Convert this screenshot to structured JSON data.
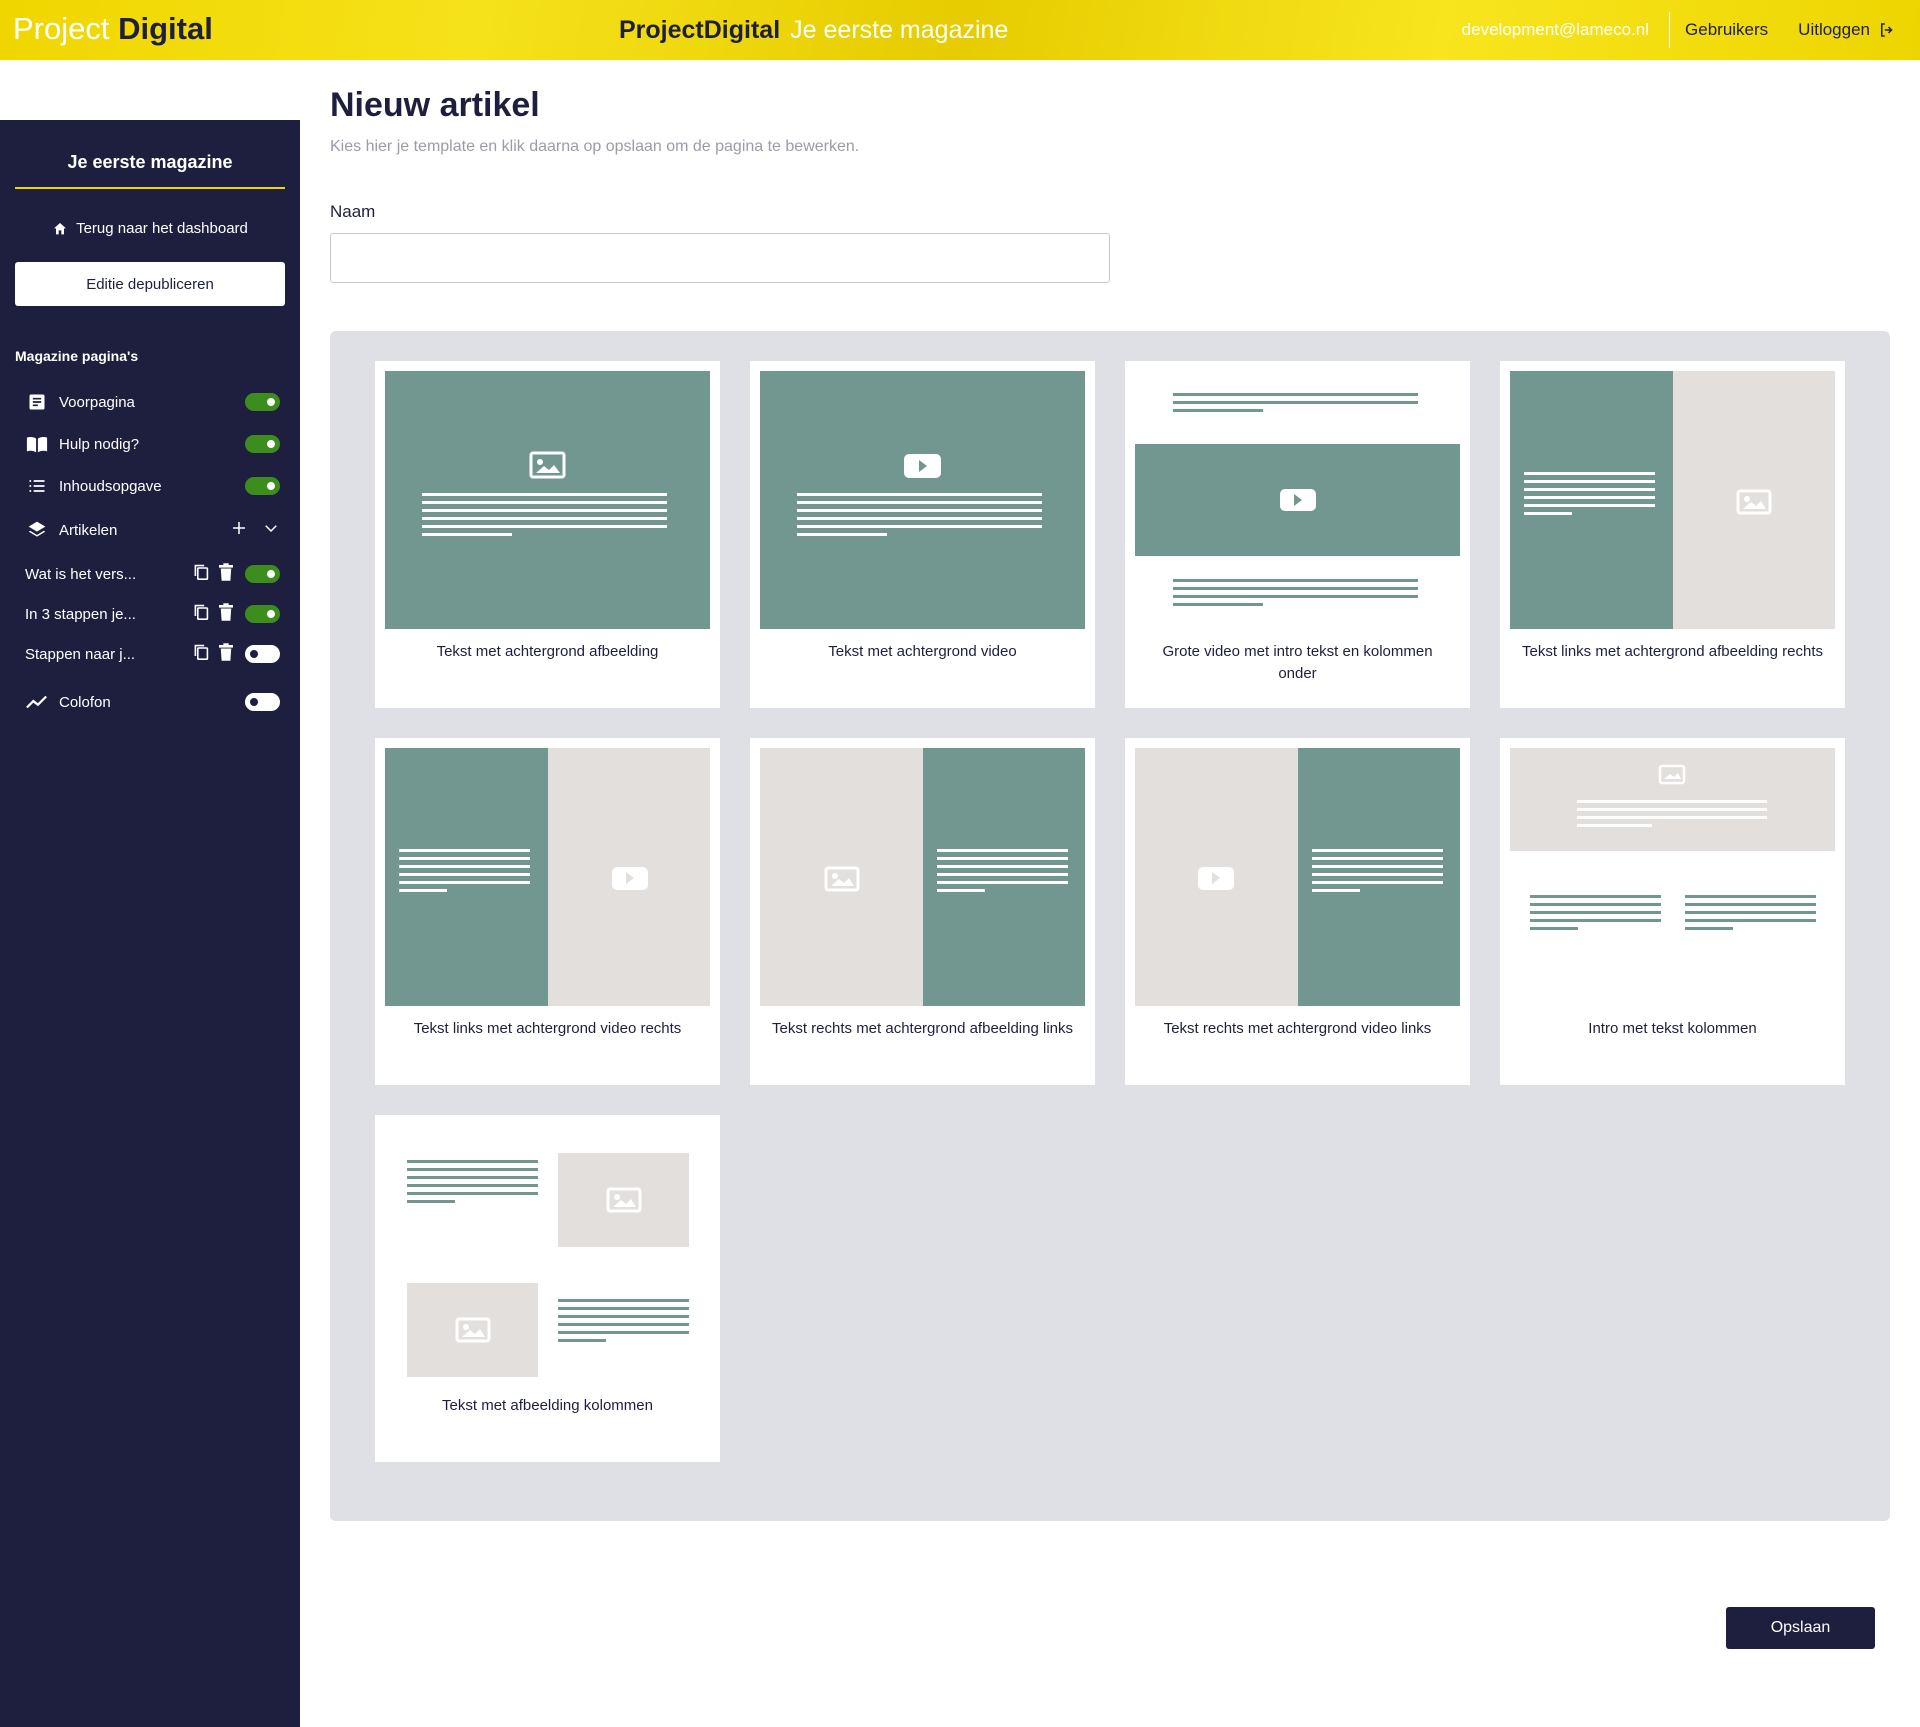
{
  "header": {
    "logo_light": "Project",
    "logo_bold": "Digital",
    "app_name": "ProjectDigital",
    "magazine_name": "Je eerste magazine",
    "email": "development@lameco.nl",
    "users_link": "Gebruikers",
    "logout_link": "Uitloggen"
  },
  "sidebar": {
    "title": "Je eerste magazine",
    "back_link": "Terug naar het dashboard",
    "unpublish_button": "Editie depubliceren",
    "section_title": "Magazine pagina's",
    "pages": [
      {
        "label": "Voorpagina",
        "icon": "document-icon",
        "enabled": true
      },
      {
        "label": "Hulp nodig?",
        "icon": "book-icon",
        "enabled": true
      },
      {
        "label": "Inhoudsopgave",
        "icon": "list-icon",
        "enabled": true
      }
    ],
    "articles_label": "Artikelen",
    "articles": [
      {
        "label": "Wat is het vers...",
        "enabled": true
      },
      {
        "label": "In 3 stappen je...",
        "enabled": true
      },
      {
        "label": "Stappen naar j...",
        "enabled": false
      }
    ],
    "colofon": {
      "label": "Colofon",
      "enabled": false
    }
  },
  "main": {
    "title": "Nieuw artikel",
    "subtitle": "Kies hier je template en klik daarna op opslaan om de pagina te bewerken.",
    "name_label": "Naam",
    "name_value": "",
    "templates": [
      {
        "label": "Tekst met achtergrond afbeelding"
      },
      {
        "label": "Tekst met achtergrond video"
      },
      {
        "label": "Grote video met intro tekst en kolommen onder"
      },
      {
        "label": "Tekst links met achtergrond afbeelding rechts"
      },
      {
        "label": "Tekst links met achtergrond video rechts"
      },
      {
        "label": "Tekst rechts met achtergrond afbeelding links"
      },
      {
        "label": "Tekst rechts met achtergrond video links"
      },
      {
        "label": "Intro met tekst kolommen"
      },
      {
        "label": "Tekst met afbeelding kolommen"
      }
    ],
    "save_button": "Opslaan"
  },
  "colors": {
    "brand_yellow": "#f0d600",
    "navy": "#1e1f3f",
    "teal": "#729690",
    "light_gray": "#e2dfdd",
    "toggle_on": "#3c8c1e",
    "panel_bg": "#dfdfe6"
  }
}
